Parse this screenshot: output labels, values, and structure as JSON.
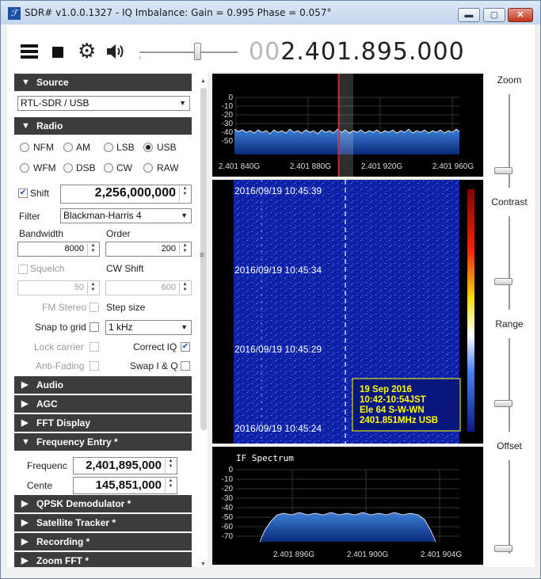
{
  "window": {
    "title": "SDR# v1.0.0.1327 - IQ Imbalance: Gain = 0.995 Phase = 0.057°",
    "app_icon": "app-logo-icon",
    "controls": {
      "minimize": "▬",
      "maximize": "▢",
      "close": "✕"
    }
  },
  "toolbar": {
    "menu_icon": "hamburger-menu-icon",
    "stop_icon": "stop-icon",
    "settings_icon": "gear-icon",
    "audio_icon": "speaker-icon",
    "volume": 0.6,
    "frequency_dim": "00",
    "frequency_main": "2.401.895.000"
  },
  "source": {
    "header": "Source",
    "device": "RTL-SDR / USB"
  },
  "radio": {
    "header": "Radio",
    "modes": [
      "NFM",
      "AM",
      "LSB",
      "USB",
      "WFM",
      "DSB",
      "CW",
      "RAW"
    ],
    "selected_mode": "USB",
    "shift_label": "Shift",
    "shift_checked": true,
    "shift_value": "2,256,000,000",
    "filter_label": "Filter",
    "filter_value": "Blackman-Harris 4",
    "bandwidth_label": "Bandwidth",
    "bandwidth_value": "8000",
    "order_label": "Order",
    "order_value": "200",
    "squelch_label": "Squelch",
    "squelch_value": "50",
    "cw_shift_label": "CW Shift",
    "cw_shift_value": "600",
    "fm_stereo_label": "FM Stereo",
    "step_size_label": "Step size",
    "snap_to_grid_label": "Snap to grid",
    "step_size_value": "1 kHz",
    "lock_carrier_label": "Lock carrier",
    "correct_iq_label": "Correct IQ",
    "correct_iq_checked": true,
    "anti_fading_label": "Anti-Fading",
    "swap_iq_label": "Swap I & Q"
  },
  "sections": {
    "audio": "Audio",
    "agc": "AGC",
    "fft_display": "FFT Display",
    "frequency_entry": "Frequency Entry *",
    "qpsk": "QPSK Demodulator *",
    "satellite": "Satellite Tracker *",
    "recording": "Recording *",
    "zoom_fft": "Zoom FFT *"
  },
  "frequency_entry": {
    "frequency_label": "Frequenc",
    "frequency_value": "2,401,895,000",
    "center_label": "Cente",
    "center_value": "145,851,000"
  },
  "spectrum": {
    "y_ticks": [
      "0",
      "-10",
      "-20",
      "-30",
      "-40",
      "-50"
    ],
    "x_ticks": [
      "2.401 840G",
      "2.401 880G",
      "2.401 920G",
      "2.401 960G"
    ]
  },
  "waterfall": {
    "timestamps": [
      "2016/09/19 10:45:39",
      "2016/09/19 10:45:34",
      "2016/09/19 10:45:29",
      "2016/09/19 10:45:24"
    ],
    "overlay": [
      "19 Sep 2016",
      "10:42-10:54JST",
      "Ele 64 S-W-WN",
      "2401.851MHz USB"
    ]
  },
  "if_spectrum": {
    "title": "IF Spectrum",
    "y_ticks": [
      "0",
      "-10",
      "-20",
      "-30",
      "-40",
      "-50",
      "-60",
      "-70"
    ],
    "x_ticks": [
      "2.401 896G",
      "2.401 900G",
      "2.401 904G"
    ]
  },
  "right_sliders": {
    "zoom": {
      "label": "Zoom",
      "level": 0.18
    },
    "contrast": {
      "label": "Contrast",
      "level": 0.3
    },
    "range": {
      "label": "Range",
      "level": 0.3
    },
    "offset": {
      "label": "Offset",
      "level": 0.05
    }
  },
  "colors": {
    "accent": "#1c4fa8",
    "section_header": "#3c3c3c",
    "waterfall_bg": "#0c1fa8",
    "overlay_text": "#ffff00",
    "cursor": "#e02020"
  }
}
